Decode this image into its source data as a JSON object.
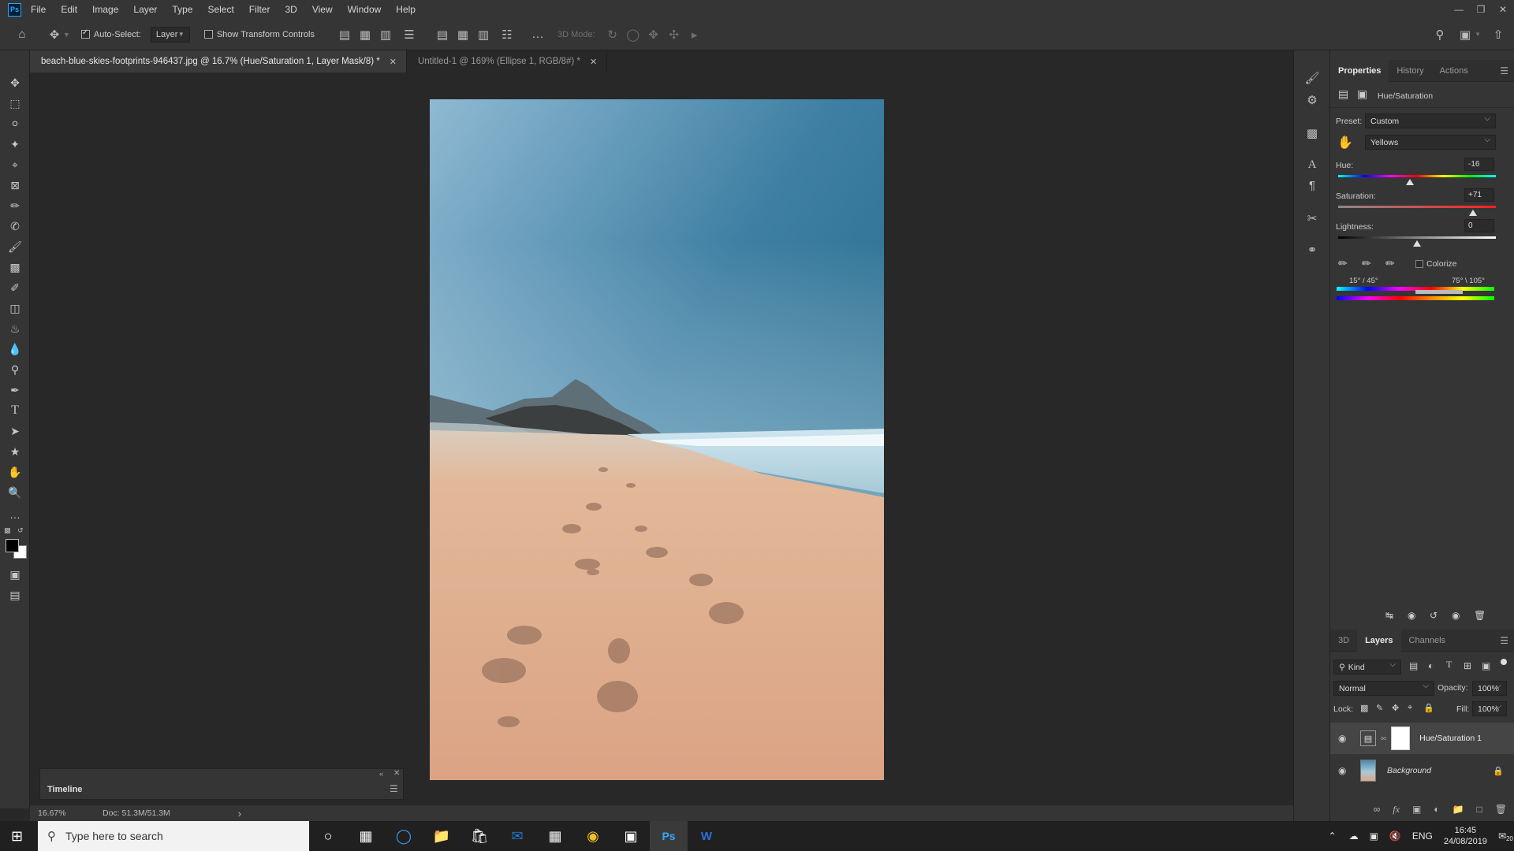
{
  "menu": {
    "logo": "Ps",
    "items": [
      "File",
      "Edit",
      "Image",
      "Layer",
      "Type",
      "Select",
      "Filter",
      "3D",
      "View",
      "Window",
      "Help"
    ]
  },
  "options": {
    "auto_select_label": "Auto-Select:",
    "auto_select_value": "Layer",
    "show_transform_label": "Show Transform Controls",
    "mode_3d_label": "3D Mode:"
  },
  "tabs": [
    {
      "label": "beach-blue-skies-footprints-946437.jpg @ 16.7% (Hue/Saturation 1, Layer Mask/8) *",
      "active": true
    },
    {
      "label": "Untitled-1 @ 169% (Ellipse 1, RGB/8#) *",
      "active": false
    }
  ],
  "timeline": {
    "title": "Timeline"
  },
  "status": {
    "zoom": "16.67%",
    "doc": "Doc: 51.3M/51.3M",
    "arrow": "›"
  },
  "properties": {
    "tabs": [
      "Properties",
      "History",
      "Actions"
    ],
    "adjustment_title": "Hue/Saturation",
    "preset_label": "Preset:",
    "preset_value": "Custom",
    "channel_value": "Yellows",
    "hue_label": "Hue:",
    "hue_value": "-16",
    "hue_level": -16,
    "saturation_label": "Saturation:",
    "saturation_value": "+71",
    "saturation_level": 71,
    "lightness_label": "Lightness:",
    "lightness_value": "0",
    "lightness_level": 0,
    "colorize_label": "Colorize",
    "range_left": "15° / 45°",
    "range_right": "75° \\ 105°"
  },
  "layers": {
    "tabs": [
      "3D",
      "Layers",
      "Channels"
    ],
    "kind_label": "Kind",
    "blend_mode": "Normal",
    "opacity_label": "Opacity:",
    "opacity_value": "100%",
    "lock_label": "Lock:",
    "fill_label": "Fill:",
    "fill_value": "100%",
    "items": [
      {
        "name": "Hue/Saturation 1"
      },
      {
        "name": "Background"
      }
    ]
  },
  "taskbar": {
    "search_placeholder": "Type here to search",
    "lang": "ENG",
    "time": "16:45",
    "date": "24/08/2019",
    "notif_count": "20"
  },
  "colors": {
    "ps_accent": "#31a8ff",
    "panel_bg": "#353535",
    "canvas_bg": "#282828"
  }
}
